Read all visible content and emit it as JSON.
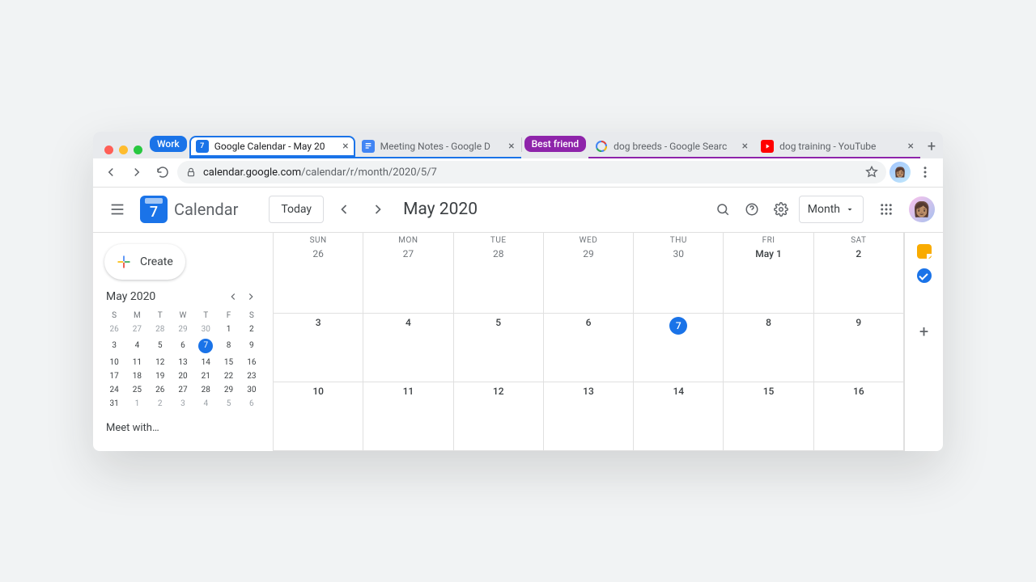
{
  "tabs": {
    "group_a_label": "Work",
    "group_b_label": "Best friend",
    "calendar": "Google Calendar - May 20",
    "docs": "Meeting Notes - Google D",
    "search": "dog breeds - Google Searc",
    "youtube": "dog training - YouTube"
  },
  "toolbar": {
    "url_host": "calendar.google.com",
    "url_path": "/calendar/r/month/2020/5/7"
  },
  "header": {
    "logo_day": "7",
    "product_name": "Calendar",
    "today_label": "Today",
    "period_title": "May 2020",
    "view_picker": "Month"
  },
  "sidebar": {
    "create_label": "Create",
    "mini_title": "May 2020",
    "dow": [
      "S",
      "M",
      "T",
      "W",
      "T",
      "F",
      "S"
    ],
    "weeks": [
      [
        {
          "n": "26",
          "m": true
        },
        {
          "n": "27",
          "m": true
        },
        {
          "n": "28",
          "m": true
        },
        {
          "n": "29",
          "m": true
        },
        {
          "n": "30",
          "m": true
        },
        {
          "n": "1"
        },
        {
          "n": "2"
        }
      ],
      [
        {
          "n": "3"
        },
        {
          "n": "4"
        },
        {
          "n": "5"
        },
        {
          "n": "6"
        },
        {
          "n": "7",
          "sel": true
        },
        {
          "n": "8"
        },
        {
          "n": "9"
        }
      ],
      [
        {
          "n": "10"
        },
        {
          "n": "11"
        },
        {
          "n": "12"
        },
        {
          "n": "13"
        },
        {
          "n": "14"
        },
        {
          "n": "15"
        },
        {
          "n": "16"
        }
      ],
      [
        {
          "n": "17"
        },
        {
          "n": "18"
        },
        {
          "n": "19"
        },
        {
          "n": "20"
        },
        {
          "n": "21"
        },
        {
          "n": "22"
        },
        {
          "n": "23"
        }
      ],
      [
        {
          "n": "24"
        },
        {
          "n": "25"
        },
        {
          "n": "26"
        },
        {
          "n": "27"
        },
        {
          "n": "28"
        },
        {
          "n": "29"
        },
        {
          "n": "30"
        }
      ],
      [
        {
          "n": "31"
        },
        {
          "n": "1",
          "m": true
        },
        {
          "n": "2",
          "m": true
        },
        {
          "n": "3",
          "m": true
        },
        {
          "n": "4",
          "m": true
        },
        {
          "n": "5",
          "m": true
        },
        {
          "n": "6",
          "m": true
        }
      ]
    ],
    "meet_with": "Meet with…"
  },
  "grid": {
    "dow": [
      "SUN",
      "MON",
      "TUE",
      "WED",
      "THU",
      "FRI",
      "SAT"
    ],
    "rows": [
      [
        {
          "t": "26"
        },
        {
          "t": "27"
        },
        {
          "t": "28"
        },
        {
          "t": "29"
        },
        {
          "t": "30"
        },
        {
          "t": "May 1",
          "dark": true
        },
        {
          "t": "2",
          "dark": true
        }
      ],
      [
        {
          "t": "3",
          "dark": true
        },
        {
          "t": "4",
          "dark": true
        },
        {
          "t": "5",
          "dark": true
        },
        {
          "t": "6",
          "dark": true
        },
        {
          "t": "7",
          "dark": true,
          "chip": true
        },
        {
          "t": "8",
          "dark": true
        },
        {
          "t": "9",
          "dark": true
        }
      ],
      [
        {
          "t": "10",
          "dark": true
        },
        {
          "t": "11",
          "dark": true
        },
        {
          "t": "12",
          "dark": true
        },
        {
          "t": "13",
          "dark": true
        },
        {
          "t": "14",
          "dark": true
        },
        {
          "t": "15",
          "dark": true
        },
        {
          "t": "16",
          "dark": true
        }
      ]
    ]
  }
}
